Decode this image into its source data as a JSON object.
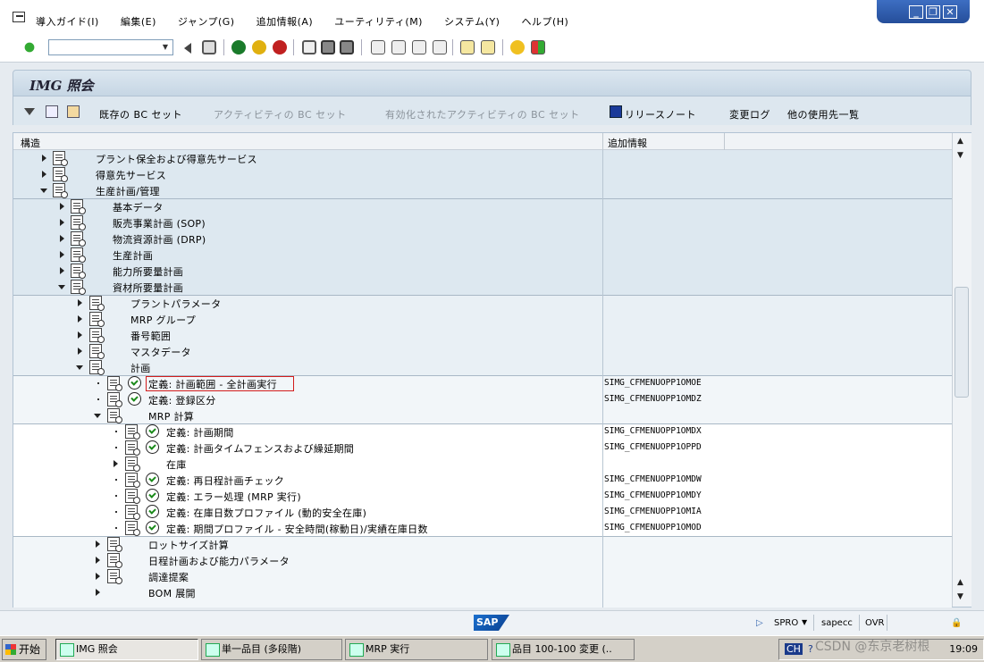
{
  "menu": [
    "導入ガイド(I)",
    "編集(E)",
    "ジャンプ(G)",
    "追加情報(A)",
    "ユーティリティ(M)",
    "システム(Y)",
    "ヘルプ(H)"
  ],
  "window_controls": [
    "_",
    "❐",
    "✕"
  ],
  "page_title": "IMG 照会",
  "app_toolbar": {
    "existing_bc_set": "既存の BC セット",
    "activity_bc_set": "アクティビティの BC セット",
    "activated_activity_bc_set": "有効化されたアクティビティの BC セット",
    "release_notes": "リリースノート",
    "change_log": "変更ログ",
    "other_where_used": "他の使用先一覧"
  },
  "tree_header": {
    "structure": "構造",
    "additional_info": "追加情報"
  },
  "tree_rows": [
    {
      "label": "プラント保全および得意先サービス",
      "info": ""
    },
    {
      "label": "得意先サービス",
      "info": ""
    },
    {
      "label": "生産計画/管理",
      "info": ""
    },
    {
      "label": "基本データ",
      "info": ""
    },
    {
      "label": "販売事業計画 (SOP)",
      "info": ""
    },
    {
      "label": "物流資源計画 (DRP)",
      "info": ""
    },
    {
      "label": "生産計画",
      "info": ""
    },
    {
      "label": "能力所要量計画",
      "info": ""
    },
    {
      "label": "資材所要量計画",
      "info": ""
    },
    {
      "label": "プラントパラメータ",
      "info": ""
    },
    {
      "label": "MRP グループ",
      "info": ""
    },
    {
      "label": "番号範囲",
      "info": ""
    },
    {
      "label": "マスタデータ",
      "info": ""
    },
    {
      "label": "計画",
      "info": ""
    },
    {
      "label": "定義: 計画範囲 - 全計画実行",
      "info": "SIMG_CFMENUOPP1OMOE"
    },
    {
      "label": "定義: 登録区分",
      "info": "SIMG_CFMENUOPP1OMDZ"
    },
    {
      "label": "MRP 計算",
      "info": ""
    },
    {
      "label": "定義: 計画期間",
      "info": "SIMG_CFMENUOPP1OMDX"
    },
    {
      "label": "定義: 計画タイムフェンスおよび繰延期間",
      "info": "SIMG_CFMENUOPP1OPPD"
    },
    {
      "label": "在庫",
      "info": ""
    },
    {
      "label": "定義: 再日程計画チェック",
      "info": "SIMG_CFMENUOPP1OMDW"
    },
    {
      "label": "定義: エラー処理 (MRP 実行)",
      "info": "SIMG_CFMENUOPP1OMDY"
    },
    {
      "label": "定義: 在庫日数プロファイル (動的安全在庫)",
      "info": "SIMG_CFMENUOPP1OMIA"
    },
    {
      "label": "定義: 期間プロファイル - 安全時間(稼動日)/実績在庫日数",
      "info": "SIMG_CFMENUOPP1OMOD"
    },
    {
      "label": "ロットサイズ計算",
      "info": ""
    },
    {
      "label": "日程計画および能力パラメータ",
      "info": ""
    },
    {
      "label": "調達提案",
      "info": ""
    },
    {
      "label": "BOM 展開",
      "info": ""
    }
  ],
  "status": {
    "transaction": "SPRO",
    "server": "sapecc",
    "mode": "OVR"
  },
  "taskbar": {
    "start": "开始",
    "tasks": [
      "IMG 照会",
      "単一品目 (多段階)",
      "MRP 実行",
      "品目 100-100 変更 (.."
    ],
    "lang": "CH",
    "time": "19:09"
  },
  "watermark": "CSDN @东京老树根"
}
